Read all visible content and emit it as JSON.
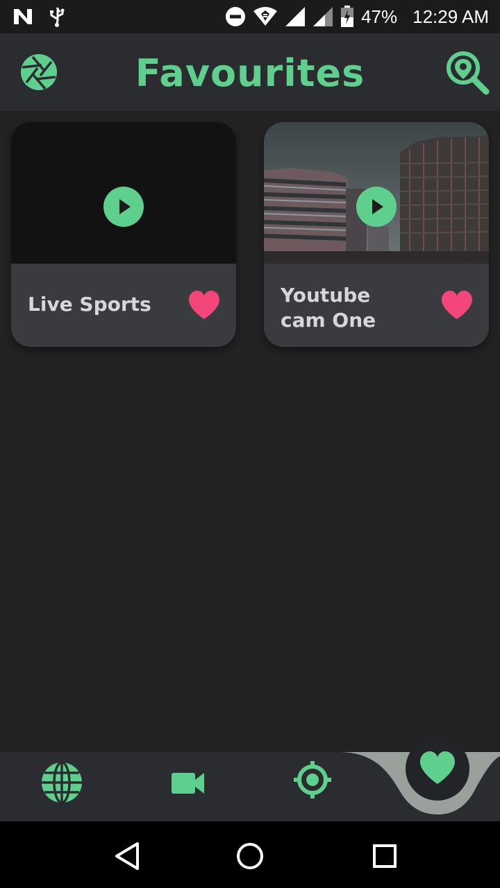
{
  "status_bar": {
    "battery": "47%",
    "time": "12:29 AM",
    "icons": [
      "n-icon",
      "usb-icon",
      "do-not-disturb-icon",
      "wifi-icon",
      "signal-icon",
      "signal-icon",
      "battery-icon"
    ]
  },
  "app_bar": {
    "title": "Favourites",
    "left_icon": "camera-aperture-icon",
    "right_icon": "search-location-icon"
  },
  "cards": [
    {
      "title": "Live Sports",
      "thumbnail": "black",
      "favourite": true
    },
    {
      "title": "Youtube cam One",
      "thumbnail": "city-buildings-photo",
      "favourite": true
    }
  ],
  "bottom_nav": {
    "items": [
      "globe-icon",
      "video-camera-icon",
      "target-icon",
      "heart-icon"
    ],
    "active": "heart-icon"
  },
  "system_nav": [
    "back-icon",
    "home-icon",
    "recents-icon"
  ],
  "colors": {
    "accent": "#5fcf8e",
    "heart": "#f3467b",
    "background": "#222222",
    "app_bar": "#2b2c2f",
    "card": "#3a3b3e"
  }
}
